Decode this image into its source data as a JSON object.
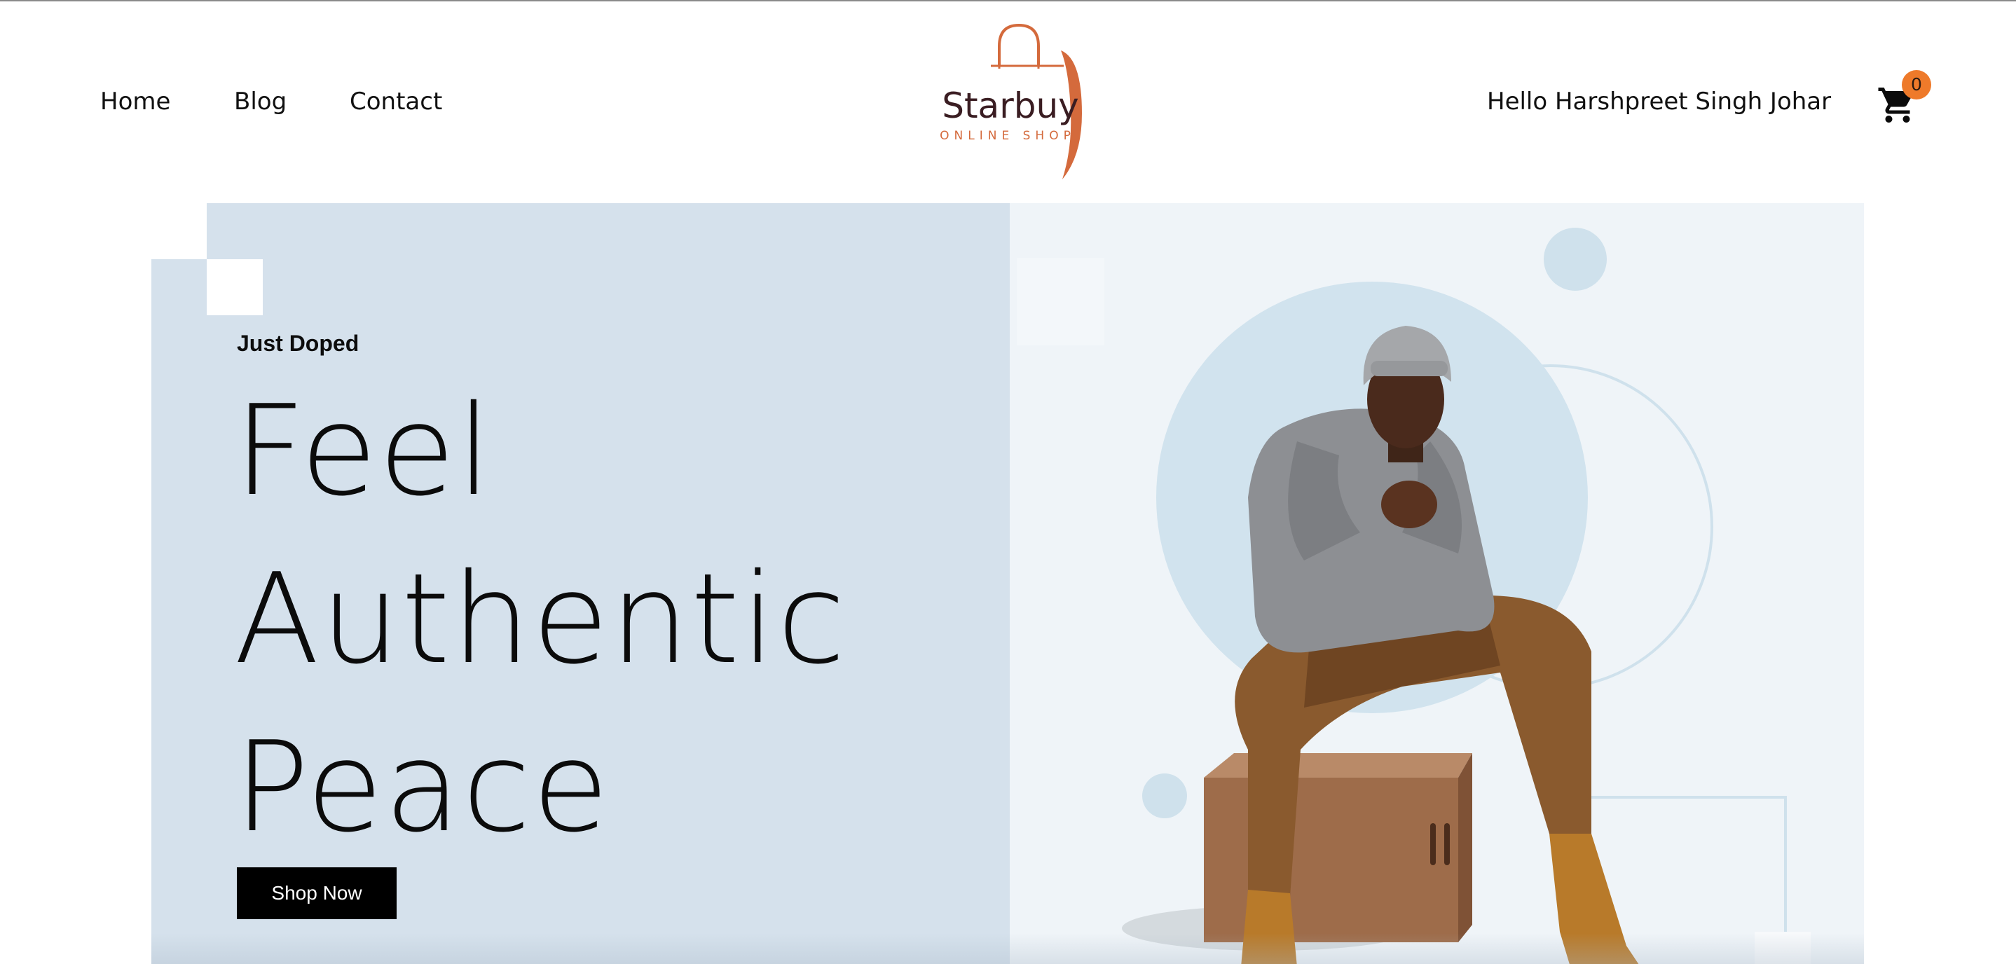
{
  "header": {
    "nav": {
      "home": "Home",
      "blog": "Blog",
      "contact": "Contact"
    },
    "logo": {
      "name": "Starbuy",
      "tagline": "ONLINE SHOP"
    },
    "greeting": "Hello Harshpreet Singh Johar",
    "cart": {
      "count": "0",
      "icon": "shopping-cart-icon"
    }
  },
  "hero": {
    "eyebrow": "Just Doped",
    "headline": [
      "Feel",
      "Authentic",
      "Peace"
    ],
    "cta_label": "Shop Now"
  },
  "colors": {
    "accent": "#ee7a2a",
    "logo_text": "#3a1d22",
    "logo_orange": "#d46a3c",
    "hero_left_bg": "#d5e1ec",
    "hero_right_bg": "#eff4f8",
    "button_bg": "#000000"
  }
}
